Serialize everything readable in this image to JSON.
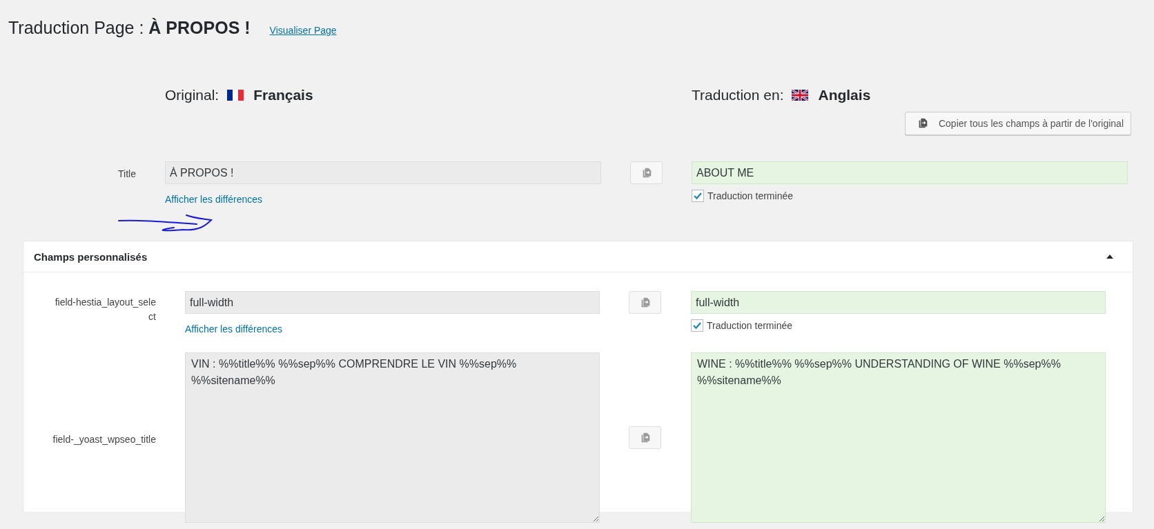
{
  "page": {
    "title_prefix": "Traduction Page :",
    "title_name": "À PROPOS !",
    "view_link": "Visualiser Page"
  },
  "languages": {
    "original_label": "Original:",
    "original_flag": {
      "kind": "france"
    },
    "original_lang": "Français",
    "translation_label": "Traduction en:",
    "translation_flag": {
      "kind": "uk"
    },
    "translation_lang": "Anglais"
  },
  "copy_all_button": "Copier tous les champs à partir de l'original",
  "title_field": {
    "label": "Title",
    "kind": "input",
    "original": "À PROPOS !",
    "translation": "ABOUT ME",
    "diff_link": "Afficher les différences",
    "done_label": "Traduction terminée",
    "done": true
  },
  "annotation": {
    "kind": "arrow"
  },
  "custom_fields": {
    "title": "Champs personnalisés",
    "expanded": true,
    "fields": [
      {
        "label": "field-hestia_layout_select",
        "kind": "input",
        "original": "full-width",
        "translation": "full-width",
        "diff_link": "Afficher les différences",
        "done_label": "Traduction terminée",
        "done": true
      },
      {
        "label": "field-_yoast_wpseo_title",
        "kind": "textarea",
        "original": "VIN : %%title%% %%sep%% COMPRENDRE LE VIN %%sep%% %%sitename%%",
        "translation": "WINE : %%title%% %%sep%% UNDERSTANDING OF WINE %%sep%% %%sitename%%"
      }
    ]
  }
}
